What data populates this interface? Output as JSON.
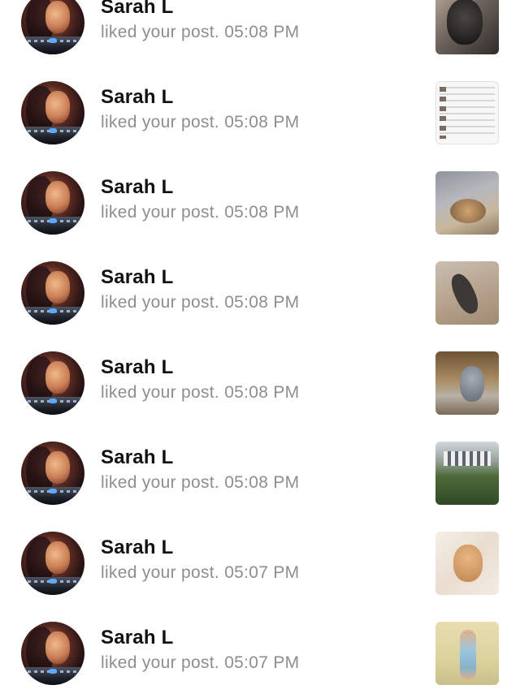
{
  "notifications": [
    {
      "user": "Sarah L",
      "action": "liked your post.",
      "time": "05:08 PM",
      "thumb": "dark-cat-closeup"
    },
    {
      "user": "Sarah L",
      "action": "liked your post.",
      "time": "05:08 PM",
      "thumb": "screenshot-list"
    },
    {
      "user": "Sarah L",
      "action": "liked your post.",
      "time": "05:08 PM",
      "thumb": "cat-on-floor"
    },
    {
      "user": "Sarah L",
      "action": "liked your post.",
      "time": "05:08 PM",
      "thumb": "black-cat-stretch"
    },
    {
      "user": "Sarah L",
      "action": "liked your post.",
      "time": "05:08 PM",
      "thumb": "gray-cat-doorway"
    },
    {
      "user": "Sarah L",
      "action": "liked your post.",
      "time": "05:08 PM",
      "thumb": "house-trees"
    },
    {
      "user": "Sarah L",
      "action": "liked your post.",
      "time": "05:07 PM",
      "thumb": "kitten-blanket"
    },
    {
      "user": "Sarah L",
      "action": "liked your post.",
      "time": "05:07 PM",
      "thumb": "child-standing"
    }
  ]
}
